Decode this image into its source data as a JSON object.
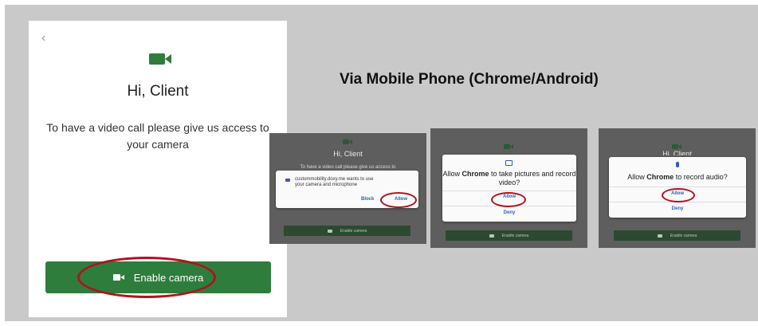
{
  "main": {
    "back_icon": "‹",
    "title": "Hi, Client",
    "message": "To have a video call please give us access to your camera",
    "enable_button": "Enable camera"
  },
  "heading": "Via Mobile Phone (Chrome/Android)",
  "thumb1": {
    "title": "Hi, Client",
    "message": "To have a video call please give us access to",
    "prompt_text": "custommobility.doxy.me wants to use your camera and microphone",
    "block": "Block",
    "allow": "Allow",
    "button": "Enable camera"
  },
  "thumb2": {
    "dialog_title_pre": "Allow ",
    "dialog_title_bold": "Chrome",
    "dialog_title_post": " to take pictures and record video?",
    "allow": "Allow",
    "deny": "Deny",
    "button": "Enable camera"
  },
  "thumb3": {
    "title_partial": "Hi, Client",
    "dialog_title_pre": "Allow ",
    "dialog_title_bold": "Chrome",
    "dialog_title_post": " to record audio?",
    "allow": "Allow",
    "deny": "Deny",
    "button": "Enable camera"
  },
  "colors": {
    "brand_green": "#2e7d3c",
    "annotation_red": "#b3121e",
    "link_blue": "#2d5eb8"
  }
}
